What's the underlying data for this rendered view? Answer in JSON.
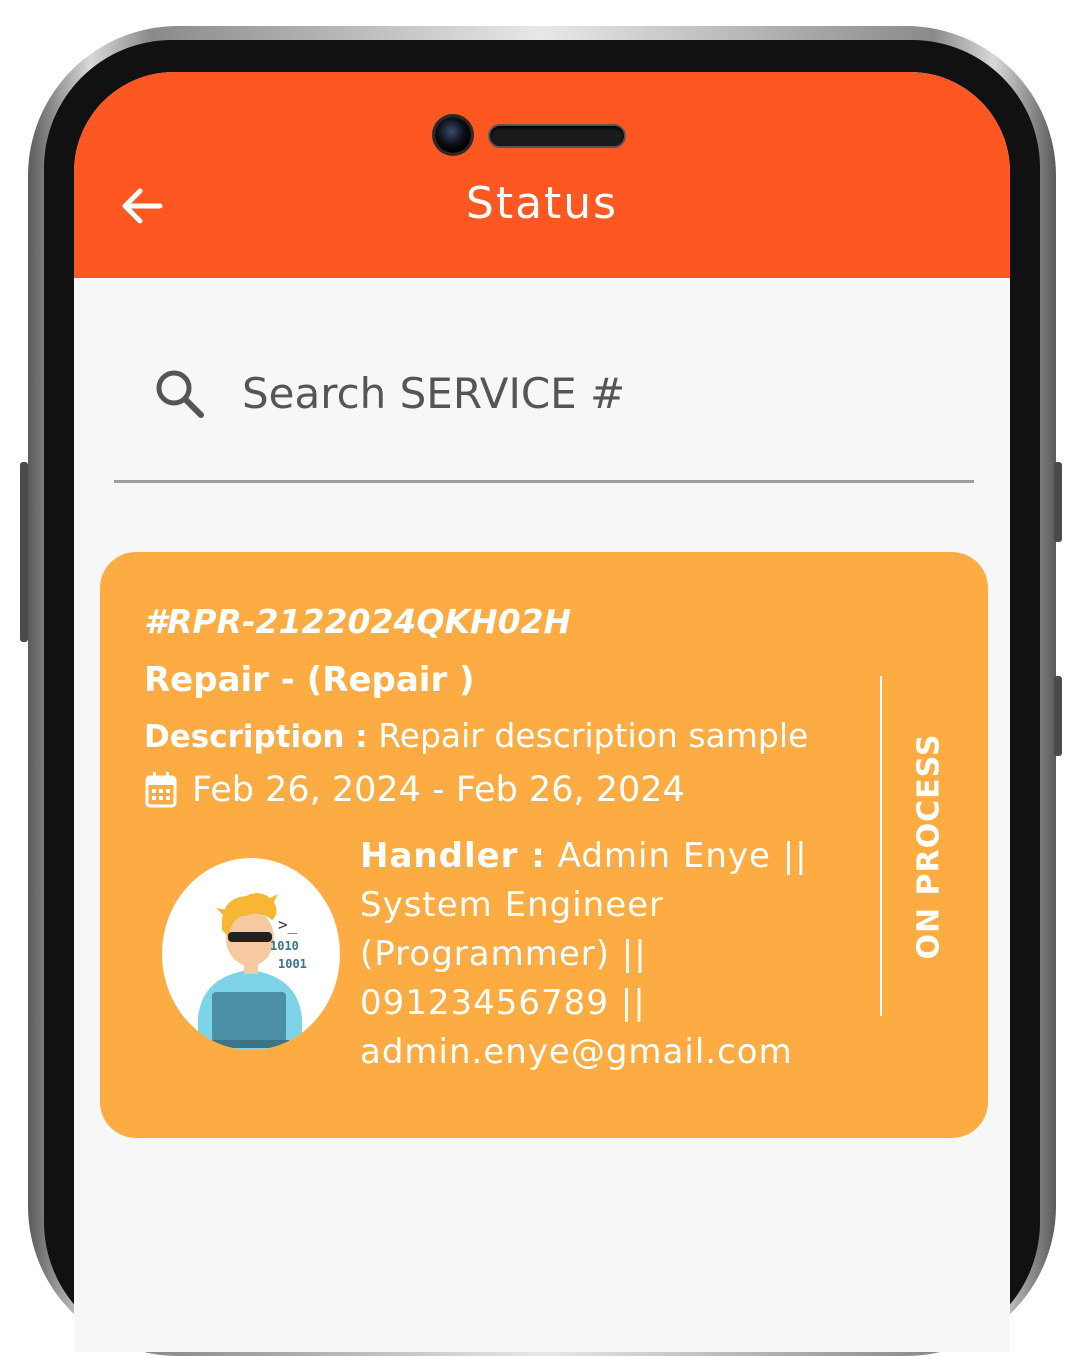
{
  "colors": {
    "app_bar": "#fe5722",
    "card": "#fcac42",
    "background": "#f7f7f7",
    "text_on_color": "#ffffff"
  },
  "header": {
    "title": "Status",
    "back_icon": "arrow-left-icon"
  },
  "search": {
    "placeholder": "Search SERVICE #",
    "value": "",
    "icon": "search-icon"
  },
  "service_card": {
    "ticket": "#RPR-2122024QKH02H",
    "service": "Repair - (Repair )",
    "description_label": "Description :",
    "description": "Repair description sample",
    "date_icon": "calendar-icon",
    "dates": "Feb 26, 2024 - Feb 26, 2024",
    "handler_label": "Handler :",
    "handler": "Admin Enye || System Engineer (Programmer) || 09123456789 || admin.enye@gmail.com",
    "avatar_icon": "programmer-avatar-icon",
    "status": "ON PROCESS"
  }
}
